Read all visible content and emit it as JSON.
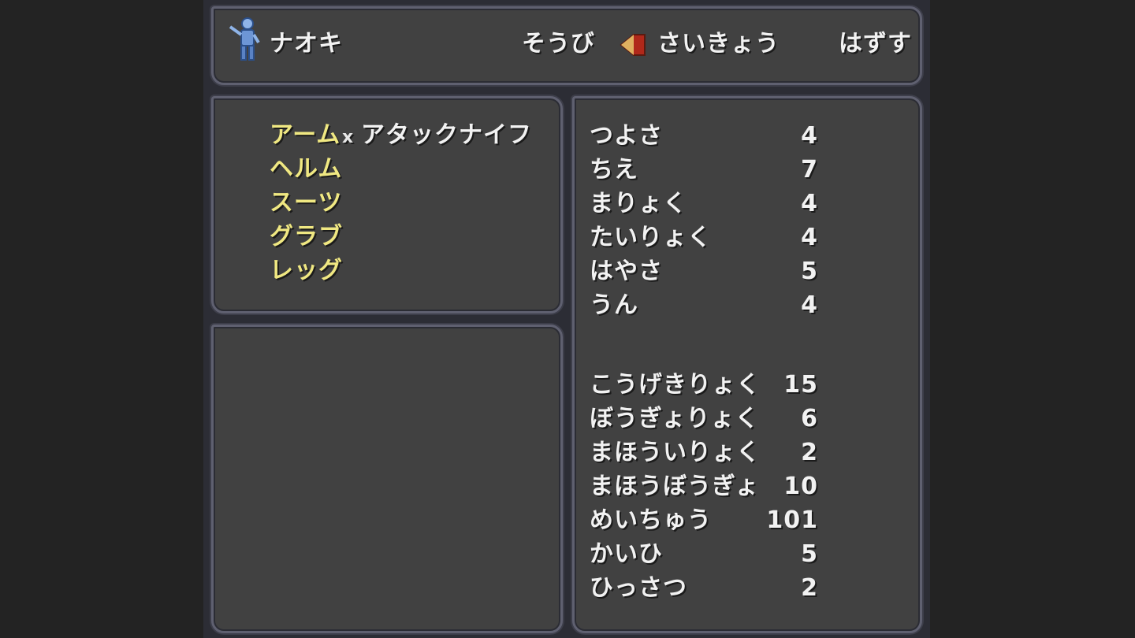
{
  "header": {
    "character_name": "ナオキ",
    "character_icon": "character-sprite-icon",
    "menu": [
      {
        "label": "そうび"
      },
      {
        "label": "さいきょう"
      },
      {
        "label": "はずす"
      }
    ],
    "cursor_icon": "cursor-arrow-icon",
    "selected_menu": "さいきょう"
  },
  "slots": [
    {
      "label": "アーム",
      "equipped": "アタックナイフ",
      "marker": "x"
    },
    {
      "label": "ヘルム",
      "equipped": ""
    },
    {
      "label": "スーツ",
      "equipped": ""
    },
    {
      "label": "グラブ",
      "equipped": ""
    },
    {
      "label": "レッグ",
      "equipped": ""
    }
  ],
  "stats": [
    {
      "label": "つよさ",
      "value": "4"
    },
    {
      "label": "ちえ",
      "value": "7"
    },
    {
      "label": "まりょく",
      "value": "4"
    },
    {
      "label": "たいりょく",
      "value": "4"
    },
    {
      "label": "はやさ",
      "value": "5"
    },
    {
      "label": "うん",
      "value": "4"
    }
  ],
  "combat_stats": [
    {
      "label": "こうげきりょく",
      "value": "15"
    },
    {
      "label": "ぼうぎょりょく",
      "value": "6"
    },
    {
      "label": "まほういりょく",
      "value": "2"
    },
    {
      "label": "まほうぼうぎょ",
      "value": "10"
    },
    {
      "label": "めいちゅう",
      "value": "101"
    },
    {
      "label": "かいひ",
      "value": "5"
    },
    {
      "label": "ひっさつ",
      "value": "2"
    }
  ],
  "colors": {
    "window_bg": "#414141",
    "window_border": "#5f6070",
    "text": "#f2f2f2",
    "slot_text": "#f0e882",
    "cursor": "#c0301e"
  }
}
